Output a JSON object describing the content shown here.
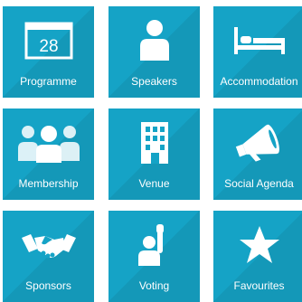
{
  "theme": {
    "tile_color": "#15a3c6",
    "icon_color": "#ffffff",
    "text_color": "#ffffff"
  },
  "tiles": [
    {
      "label": "Programme",
      "icon": "calendar-icon",
      "icon_text": "28"
    },
    {
      "label": "Speakers",
      "icon": "person-icon"
    },
    {
      "label": "Accommodation",
      "icon": "bed-icon"
    },
    {
      "label": "Membership",
      "icon": "group-icon"
    },
    {
      "label": "Venue",
      "icon": "building-icon"
    },
    {
      "label": "Social Agenda",
      "icon": "megaphone-icon"
    },
    {
      "label": "Sponsors",
      "icon": "handshake-icon"
    },
    {
      "label": "Voting",
      "icon": "raised-hand-icon"
    },
    {
      "label": "Favourites",
      "icon": "star-icon"
    }
  ]
}
